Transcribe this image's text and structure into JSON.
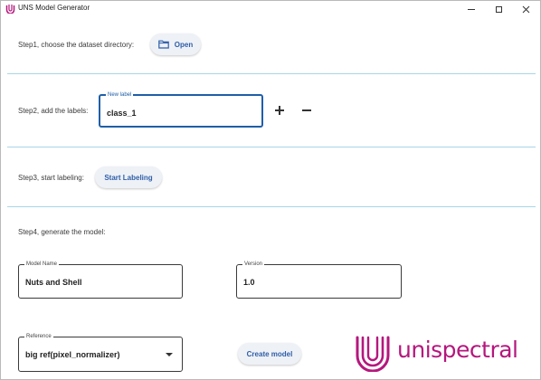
{
  "window": {
    "title": "UNS Model Generator"
  },
  "step1": {
    "label": "Step1, choose the dataset directory:",
    "open_button": "Open"
  },
  "step2": {
    "label": "Step2, add the labels:",
    "new_label_legend": "New label",
    "new_label_value": "class_1"
  },
  "step3": {
    "label": "Step3, start labeling:",
    "start_button": "Start Labeling"
  },
  "step4": {
    "label": "Step4, generate the model:",
    "model_name_legend": "Model Name",
    "model_name_value": "Nuts and Shell",
    "version_legend": "Version",
    "version_value": "1.0",
    "reference_legend": "Reference",
    "reference_value": "big ref(pixel_normalizer)",
    "create_button": "Create model"
  },
  "brand": {
    "logo_text": "unispectral",
    "color": "#b5177d"
  },
  "colors": {
    "accent": "#2f5ea8",
    "divider": "#a9d5e6",
    "focus_border": "#1f5fa8"
  }
}
